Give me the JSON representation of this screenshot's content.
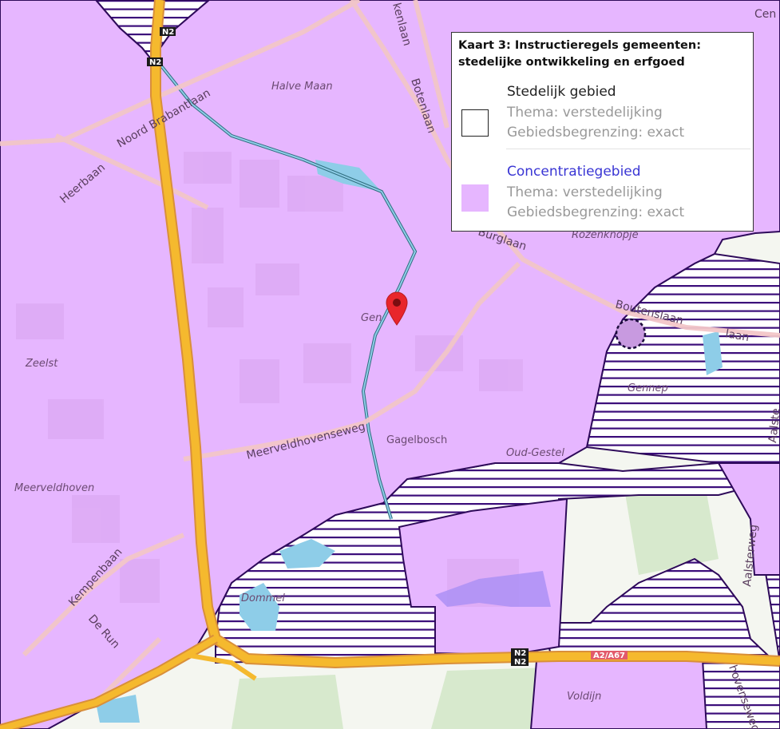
{
  "legend": {
    "title": "Kaart 3: Instructieregels gemeenten: stedelijke ontwikkeling en erfgoed",
    "items": [
      {
        "name": "Stedelijk gebied",
        "thema": "Thema: verstedelijking",
        "begrenzing": "Gebiedsbegrenzing: exact",
        "swatch": "#ffffff",
        "is_link": false
      },
      {
        "name": "Concentratiegebied",
        "thema": "Thema: verstedelijking",
        "begrenzing": "Gebiedsbegrenzing: exact",
        "swatch": "#e6b6ff",
        "is_link": true
      }
    ]
  },
  "map": {
    "place_labels": [
      "Halve Maan",
      "Zeelst",
      "Meerveldhoven",
      "Gagelbosch",
      "Oud-Gestel",
      "Gennep",
      "Rozenknopje",
      "Voldijn",
      "Dommel",
      "Gen"
    ],
    "road_labels": [
      "Noord Brabantlaan",
      "Heerbaan",
      "Botenlaan",
      "Meerveldhovenseweg",
      "Kempenbaan",
      "De Run",
      "Boutenslaan",
      "Aalsterweg",
      "Aalste",
      "Burglaan",
      "hovenseweg",
      "kenlaan",
      "Cen",
      "laan"
    ],
    "shields": [
      "N2",
      "N2",
      "N2",
      "N2",
      "A2/A67"
    ],
    "colors": {
      "concentratiegebied": "#e6b6ff",
      "marker": "#e8262b",
      "motorway": "#f5b92e",
      "water": "#8ecde8",
      "hatch": "#3b0d7a",
      "outline": "#2e0a5a"
    }
  }
}
